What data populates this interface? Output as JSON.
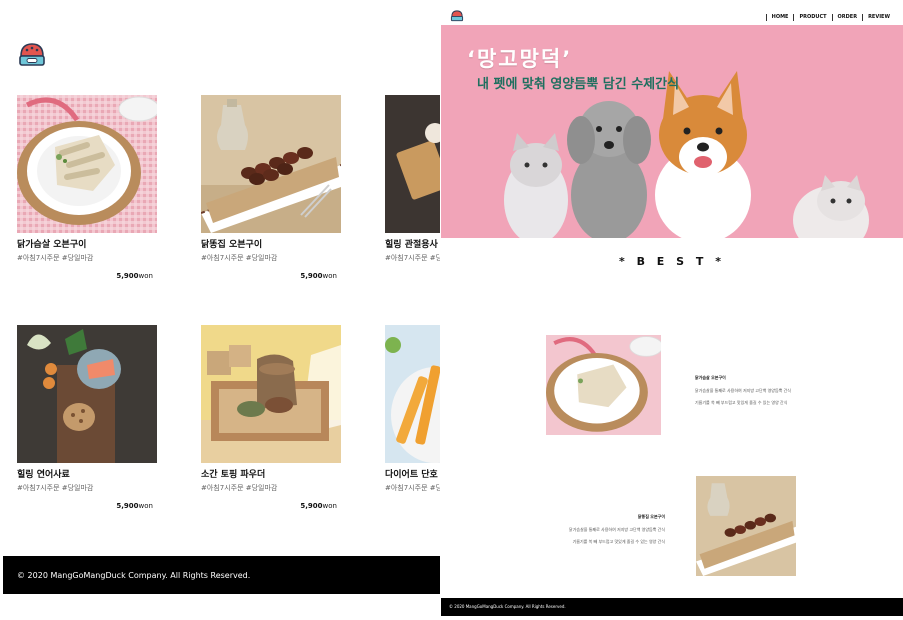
{
  "product_page": {
    "products": [
      {
        "name": "닭가슴살 오븐구이",
        "tags": "#아침7시주문 #당일마감",
        "price": "5,900",
        "unit": "won"
      },
      {
        "name": "닭똥집 오븐구이",
        "tags": "#아침7시주문 #당일마감",
        "price": "5,900",
        "unit": "won"
      },
      {
        "name": "힐링 관절용사",
        "tags": "#아침7시주문 #당",
        "price": "",
        "unit": ""
      },
      {
        "name": "힐링 연어사료",
        "tags": "#아침7시주문 #당일마감",
        "price": "5,900",
        "unit": "won"
      },
      {
        "name": "소간 토핑 파우더",
        "tags": "#아침7시주문 #당일마감",
        "price": "5,900",
        "unit": "won"
      },
      {
        "name": "다이어트 단호",
        "tags": "#아침7시주문 #당",
        "price": "",
        "unit": ""
      }
    ],
    "footer": "© 2020 MangGoMangDuck Company. All Rights Reserved."
  },
  "home_page": {
    "nav": [
      "HOME",
      "PRODUCT",
      "ORDER",
      "REVIEW"
    ],
    "hero": {
      "title": "‘망고망덕’",
      "subtitle": "내 펫에 맞춰 영양듬뿍 담긴 수제간식"
    },
    "best_title": "* B E S T *",
    "best_items": [
      {
        "title": "닭가슴살 오븐구이",
        "line1": "닭가슴살을 통째로 사용하여 저지방 고단백 영양듬뿍 간식",
        "line2": "기름기를 쏙 빼 부드럽고 맛있게 즐길 수 있는 영양 간식"
      },
      {
        "title": "닭똥집 오븐구이",
        "line1": "닭가슴살을 통째로 사용하여 저지방 고단백 영양듬뿍 간식",
        "line2": "기름기를 쏙 빼 부드럽고 맛있게 즐길 수 있는 영양 간식"
      }
    ],
    "footer": "© 2020 MangGoMangDuck Company. All Rights Reserved."
  },
  "colors": {
    "hero_background": "#f1a4b8",
    "hero_subtitle": "#1f6f5f",
    "footer_background": "#000000"
  }
}
